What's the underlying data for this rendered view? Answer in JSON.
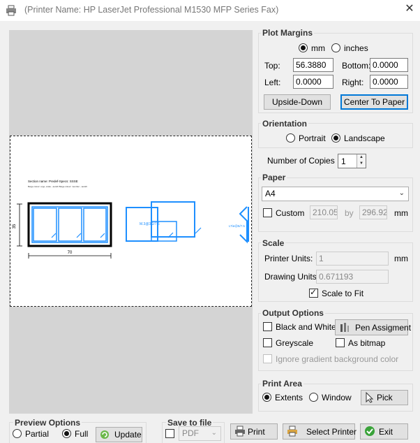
{
  "window": {
    "title": "(Printer Name: HP LaserJet Professional M1530 MFP Series Fax)",
    "close_glyph": "✕"
  },
  "drawing": {
    "section_title": "Section name: Predef-Specs: SSSE",
    "section_sub": "Beige colour: ergo, scale - autofit    Beige colour: member - autofit",
    "dim_height": "35",
    "dim_width": "70",
    "label_mid": "M.3@3/2/7.5",
    "label_right": "LTie@5/7.5"
  },
  "plot_margins": {
    "label": "Plot Margins",
    "unit_mm": "mm",
    "unit_inches": "inches",
    "selected_unit": "mm",
    "top_label": "Top:",
    "top_value": "56.3880",
    "bottom_label": "Bottom:",
    "bottom_value": "0.0000",
    "left_label": "Left:",
    "left_value": "0.0000",
    "right_label": "Right:",
    "right_value": "0.0000",
    "upside_down": "Upside-Down",
    "center_to_paper": "Center To Paper"
  },
  "orientation": {
    "label": "Orientation",
    "portrait": "Portrait",
    "landscape": "Landscape",
    "selected": "landscape"
  },
  "copies": {
    "label": "Number of Copies :",
    "value": "1"
  },
  "paper": {
    "label": "Paper",
    "selected": "A4",
    "custom_label": "Custom",
    "width": "210.05",
    "by": "by",
    "height": "296.92",
    "unit": "mm"
  },
  "scale": {
    "label": "Scale",
    "printer_units_label": "Printer Units:",
    "printer_units_value": "1",
    "printer_units_unit": "mm",
    "drawing_units_label": "Drawing Units:",
    "drawing_units_value": "0.671193",
    "scale_to_fit": "Scale to Fit",
    "scale_to_fit_checked": true
  },
  "output_options": {
    "label": "Output Options",
    "black_white": "Black and White",
    "pen_assignment": "Pen Assigment",
    "greyscale": "Greyscale",
    "as_bitmap": "As bitmap",
    "ignore_gradient": "Ignore gradient background color"
  },
  "print_area": {
    "label": "Print Area",
    "extents": "Extents",
    "window": "Window",
    "pick": "Pick",
    "selected": "extents"
  },
  "preview_options": {
    "label": "Preview Options",
    "partial": "Partial",
    "full": "Full",
    "selected": "full",
    "update": "Update"
  },
  "save_to_file": {
    "label": "Save to file",
    "format": "PDF"
  },
  "footer": {
    "print": "Print",
    "select_printer": "Select Printer",
    "exit": "Exit"
  },
  "colors": {
    "accent": "#0078d7",
    "drawing_blue": "#1e8fff"
  }
}
